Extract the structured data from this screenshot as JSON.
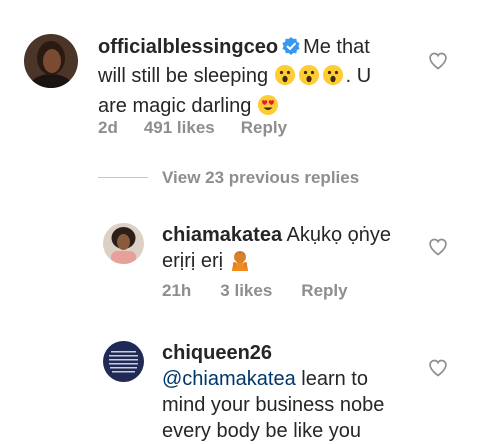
{
  "comments": [
    {
      "username": "officialblessingceo",
      "text_1": "Me that",
      "text_2": "will still be sleeping",
      "text_3": ". U",
      "text_4": "are magic darling",
      "time": "2d",
      "likes": "491 likes",
      "reply": "Reply",
      "verified": true
    },
    {
      "username": "chiamakatea",
      "text_1": "Akụkọ ọṅye",
      "text_2": "erịrị erị",
      "time": "21h",
      "likes": "3 likes",
      "reply": "Reply"
    },
    {
      "username": "chiqueen26",
      "mention": "@chiamakatea",
      "text_1": "learn to",
      "text_2": "mind your business nobe",
      "text_3": "every body be like you"
    }
  ],
  "view_previous": "View 23 previous replies",
  "icons": {
    "like": "heart-outline-icon",
    "verified": "verified-badge-icon",
    "emoji_astonished": "astonished-face-emoji",
    "emoji_heart_eyes": "heart-eyes-emoji",
    "emoji_person": "person-gesturing-emoji"
  },
  "colors": {
    "text": "#262626",
    "muted": "#8e8e8e",
    "mention": "#00376b",
    "verified": "#3897f0",
    "emoji": "#ffcc33"
  }
}
